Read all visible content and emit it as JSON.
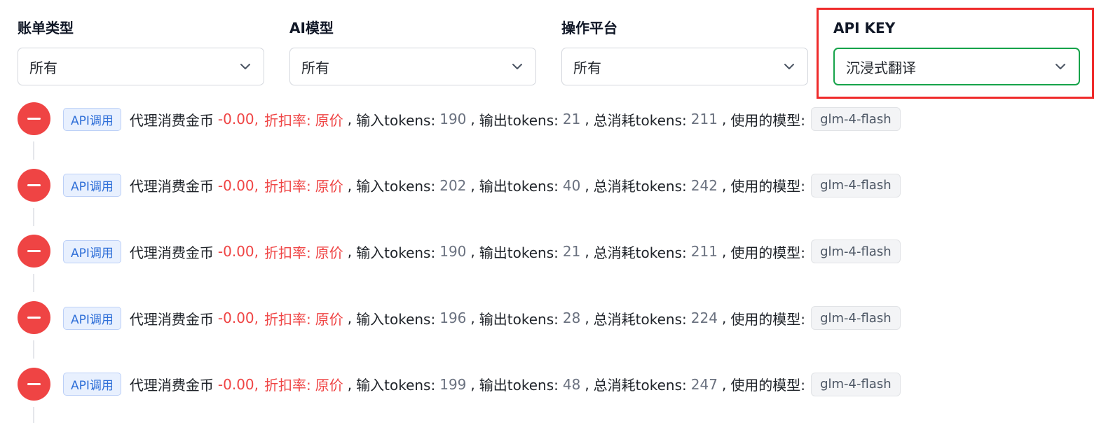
{
  "filters": [
    {
      "label": "账单类型",
      "value": "所有"
    },
    {
      "label": "AI模型",
      "value": "所有"
    },
    {
      "label": "操作平台",
      "value": "所有"
    },
    {
      "label": "API KEY",
      "value": "沉浸式翻译"
    }
  ],
  "colors": {
    "dot": "#ef4444",
    "active_border": "#16a34a",
    "highlight_border": "#ef2b2b",
    "tag_blue": "#2f6fd8"
  },
  "entry_labels": {
    "tag": "API调用",
    "desc": "代理消费金币",
    "discount_label": "折扣率:",
    "input_label": "输入tokens:",
    "output_label": "输出tokens:",
    "total_label": "总消耗tokens:",
    "model_label": "使用的模型:"
  },
  "entries": [
    {
      "amount": "-0.00,",
      "discount": "原价",
      "input": "190",
      "output": "21",
      "total": "211",
      "model": "glm-4-flash"
    },
    {
      "amount": "-0.00,",
      "discount": "原价",
      "input": "202",
      "output": "40",
      "total": "242",
      "model": "glm-4-flash"
    },
    {
      "amount": "-0.00,",
      "discount": "原价",
      "input": "190",
      "output": "21",
      "total": "211",
      "model": "glm-4-flash"
    },
    {
      "amount": "-0.00,",
      "discount": "原价",
      "input": "196",
      "output": "28",
      "total": "224",
      "model": "glm-4-flash"
    },
    {
      "amount": "-0.00,",
      "discount": "原价",
      "input": "199",
      "output": "48",
      "total": "247",
      "model": "glm-4-flash"
    }
  ]
}
